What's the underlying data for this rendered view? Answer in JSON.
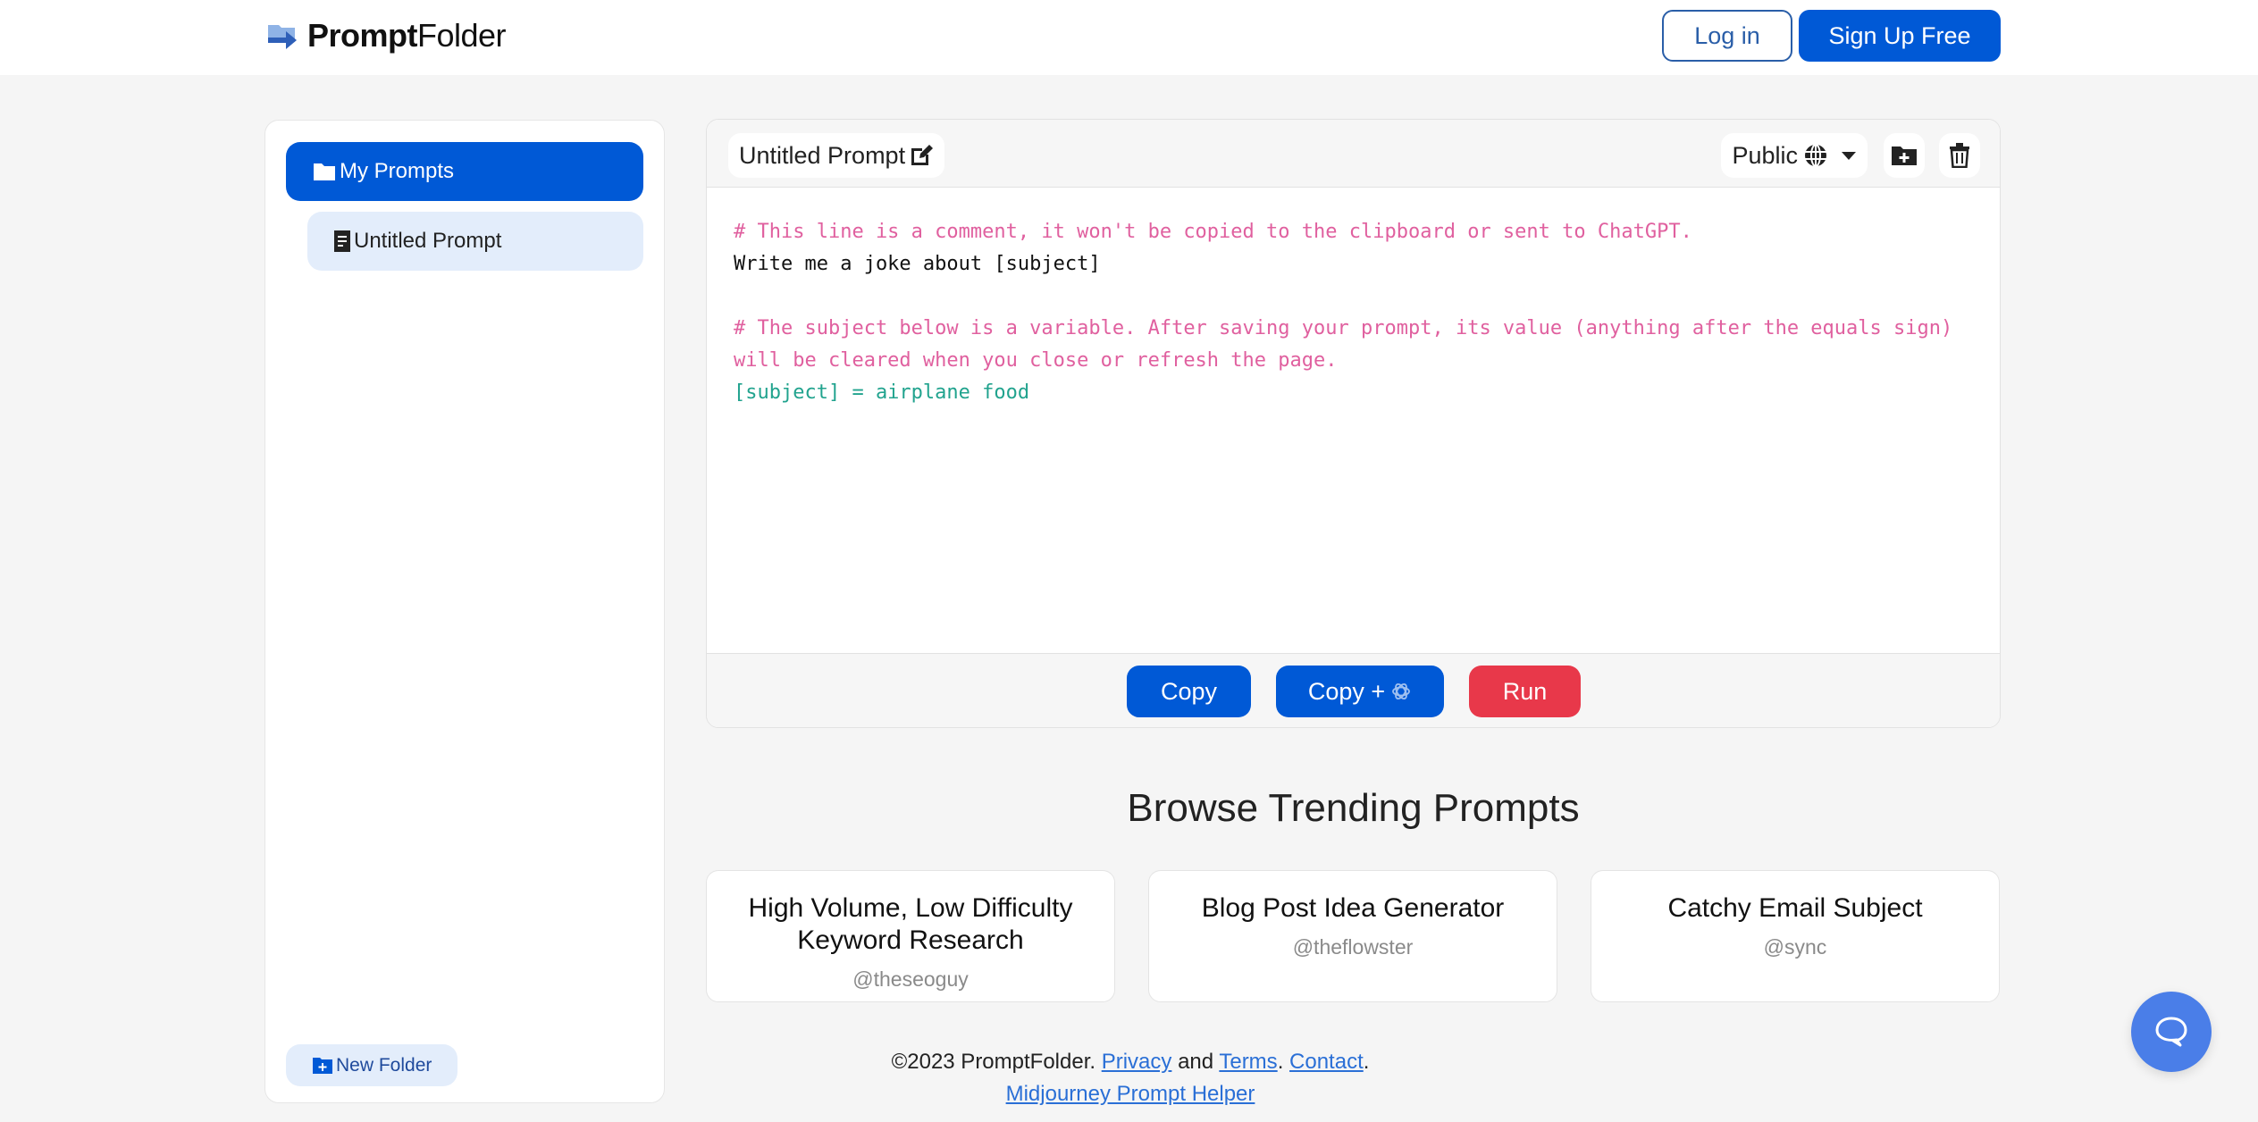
{
  "header": {
    "logo_bold": "Prompt",
    "logo_light": "Folder",
    "login_label": "Log in",
    "signup_label": "Sign Up Free"
  },
  "sidebar": {
    "folder_label": "My Prompts",
    "prompt_label": "Untitled Prompt",
    "new_folder_label": "New Folder"
  },
  "editor": {
    "title": "Untitled Prompt",
    "visibility": "Public",
    "lines": [
      {
        "type": "comment",
        "text": "# This line is a comment, it won't be copied to the clipboard or sent to ChatGPT."
      },
      {
        "type": "text",
        "text": "Write me a joke about [subject]"
      },
      {
        "type": "text",
        "text": ""
      },
      {
        "type": "comment",
        "text": "# The subject below is a variable. After saving your prompt, its value (anything after the equals sign)"
      },
      {
        "type": "comment",
        "text": "will be cleared when you close or refresh the page."
      },
      {
        "type": "var",
        "text": "[subject] = airplane food"
      }
    ],
    "actions": {
      "copy": "Copy",
      "copy_gpt": "Copy +",
      "run": "Run"
    }
  },
  "trending": {
    "title": "Browse Trending Prompts",
    "cards": [
      {
        "title": "High Volume, Low Difficulty Keyword Research",
        "author": "@theseoguy"
      },
      {
        "title": "Blog Post Idea Generator",
        "author": "@theflowster"
      },
      {
        "title": "Catchy Email Subject",
        "author": "@sync"
      }
    ]
  },
  "footer": {
    "copyright": "©2023 PromptFolder.",
    "privacy": "Privacy",
    "and": "and",
    "terms": "Terms",
    "contact": "Contact",
    "midjourney": "Midjourney Prompt Helper"
  },
  "colors": {
    "primary": "#0059d6",
    "danger": "#e8384a",
    "comment": "#e0609f",
    "variable": "#21a38e",
    "chat": "#4a7ee8"
  }
}
